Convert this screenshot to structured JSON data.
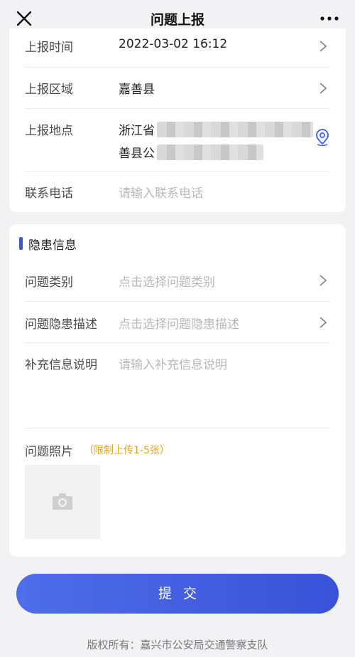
{
  "header": {
    "title": "问题上报",
    "close_icon": "close-icon",
    "more_icon": "more-dots-icon"
  },
  "basic": {
    "report_time": {
      "label": "上报时间",
      "value": "2022-03-02 16:12"
    },
    "report_area": {
      "label": "上报区域",
      "value": "嘉善县"
    },
    "report_location": {
      "label": "上报地点",
      "line1": "浙江省",
      "line2": "善县公",
      "icon": "location-pin-icon"
    },
    "phone": {
      "label": "联系电话",
      "placeholder": "请输入联系电话"
    }
  },
  "hazard": {
    "section_title": "隐患信息",
    "category": {
      "label": "问题类别",
      "placeholder": "点击选择问题类别"
    },
    "description": {
      "label": "问题隐患描述",
      "placeholder": "点击选择问题隐患描述"
    },
    "extra": {
      "label": "补充信息说明",
      "placeholder": "请输入补充信息说明"
    },
    "photos": {
      "label": "问题照片",
      "hint": "（限制上传1-5张）",
      "icon": "camera-icon"
    }
  },
  "submit_label": "提交",
  "footer": "版权所有：嘉兴市公安局交通警察支队",
  "colors": {
    "accent": "#3b55d6",
    "hint": "#e0a526"
  }
}
